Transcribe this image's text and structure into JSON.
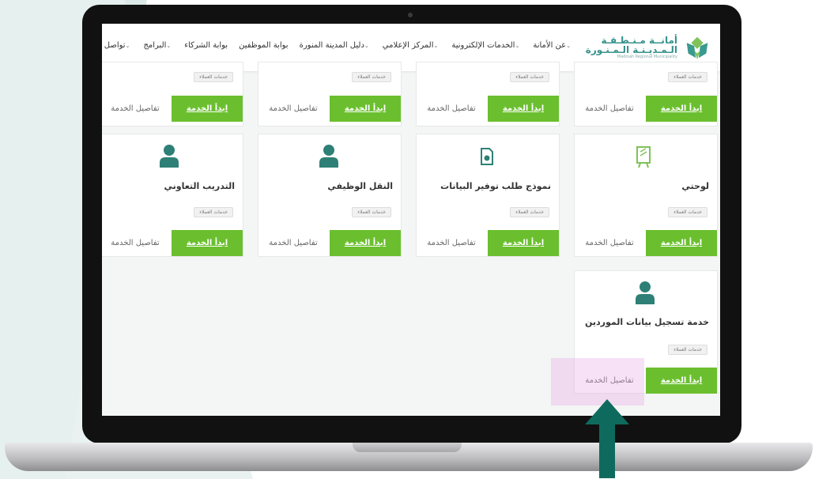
{
  "nav": {
    "logo_ar_line1": "أمانــة مـنـطـقـة",
    "logo_ar_line2": "الـمـديـنـة الـمـنـورة",
    "logo_en": "Madinah Regional Municipality",
    "items": [
      {
        "label": "عن الأمانة",
        "chevron": true
      },
      {
        "label": "الخدمات الإلكترونية",
        "chevron": true
      },
      {
        "label": "المركز الإعلامي",
        "chevron": true
      },
      {
        "label": "دليل المدينة المنورة",
        "chevron": true
      },
      {
        "label": "بوابة الموظفين",
        "chevron": false
      },
      {
        "label": "بوابة الشركاء",
        "chevron": false
      },
      {
        "label": "البرامج",
        "chevron": true
      },
      {
        "label": "تواصل معنا",
        "chevron": true
      }
    ]
  },
  "cards": {
    "tag": "خدمات العملاء",
    "start_label": "ابدأ الخدمة",
    "details_label": "تفاصيل الخدمة",
    "row2": [
      {
        "title": "لوحتي",
        "icon": "billboard-icon"
      },
      {
        "title": "نموذج طلب توفير البيانات",
        "icon": "document-icon"
      },
      {
        "title": "النقل الوظيفي",
        "icon": "person-icon"
      },
      {
        "title": "التدريب التعاوني",
        "icon": "person-icon"
      }
    ],
    "row3": [
      {
        "title": "خدمة تسجيل بيانات الموردين",
        "icon": "person-icon"
      }
    ]
  },
  "colors": {
    "accent": "#6bbf2f",
    "teal": "#2e8076",
    "arrow": "#0f6a5e"
  }
}
